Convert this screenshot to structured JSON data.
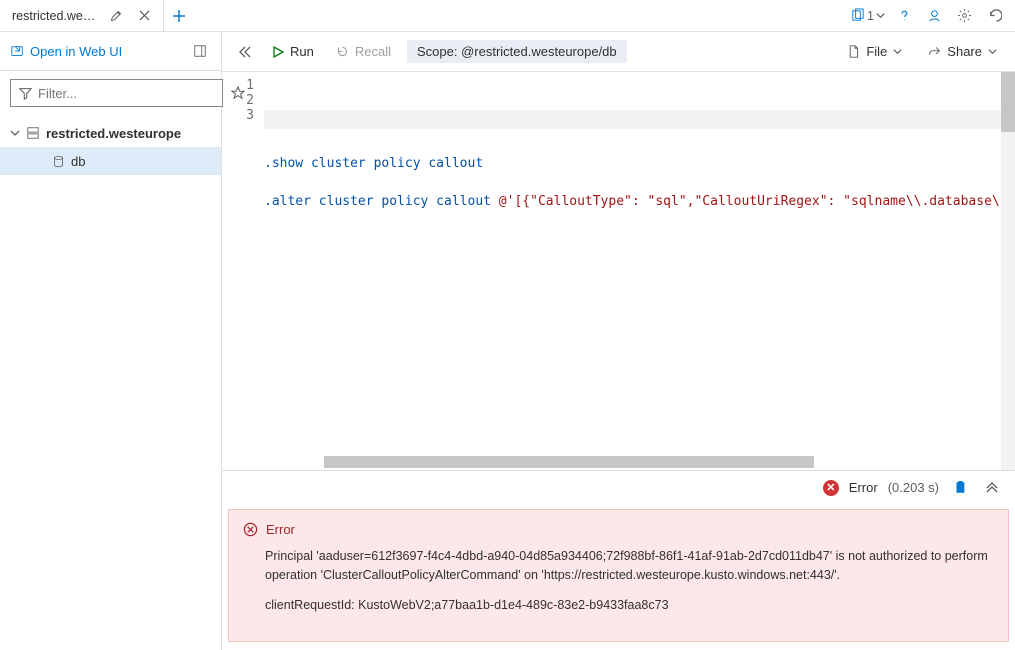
{
  "tab": {
    "title": "restricted.westeur..."
  },
  "topright": {
    "copy_count": "1"
  },
  "sidebar": {
    "open_web": "Open in Web UI",
    "filter_placeholder": "Filter...",
    "cluster": "restricted.westeurope",
    "db": "db"
  },
  "toolbar": {
    "run": "Run",
    "recall": "Recall",
    "scope_label": "Scope:",
    "scope_value": "@restricted.westeurope/db",
    "file": "File",
    "share": "Share"
  },
  "code": {
    "line1": ".show cluster policy callout",
    "line3_cmd": ".alter cluster policy callout",
    "line3_rest": " @'[{\"CalloutType\": \"sql\",\"CalloutUriRegex\": \"sqlname\\\\.database\\"
  },
  "results": {
    "status_label": "Error",
    "timing": "(0.203 s)",
    "error_title": "Error",
    "error_body1": "Principal 'aaduser=612f3697-f4c4-4dbd-a940-04d85a934406;72f988bf-86f1-41af-91ab-2d7cd011db47' is not authorized to perform operation 'ClusterCalloutPolicyAlterCommand' on 'https://restricted.westeurope.kusto.windows.net:443/'.",
    "error_body2": "clientRequestId: KustoWebV2;a77baa1b-d1e4-489c-83e2-b9433faa8c73"
  }
}
